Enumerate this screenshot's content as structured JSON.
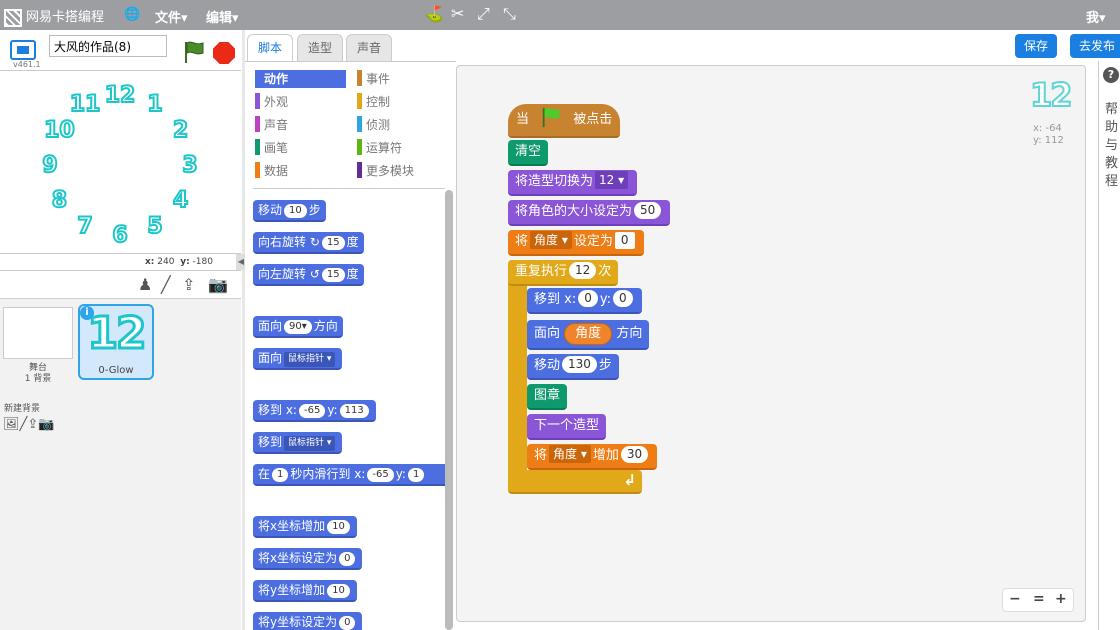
{
  "topbar": {
    "brand": "网易卡搭编程",
    "globe": "🌐",
    "file": "文件▾",
    "edit": "编辑▾",
    "user": "我▾"
  },
  "stage": {
    "version": "v461.1",
    "title_value": "大风的作品(8)",
    "coords": {
      "xl": "x:",
      "x": "240",
      "yl": "y:",
      "y": "-180"
    }
  },
  "clock": [
    "12",
    "1",
    "2",
    "3",
    "4",
    "5",
    "6",
    "7",
    "8",
    "9",
    "10",
    "11"
  ],
  "sprites": {
    "stage_label": "舞台",
    "stage_sub": "1 背景",
    "newbg": "新建背景",
    "sprite_name": "0-Glow",
    "sprite_costume": "12",
    "info": "i"
  },
  "tabs": {
    "scripts": "脚本",
    "costumes": "造型",
    "sounds": "声音"
  },
  "buttons": {
    "save": "保存",
    "publish": "去发布"
  },
  "categories": [
    {
      "label": "动作",
      "color": "#4c6ee0"
    },
    {
      "label": "事件",
      "color": "#c88330"
    },
    {
      "label": "外观",
      "color": "#8a55d7"
    },
    {
      "label": "控制",
      "color": "#e1a91a"
    },
    {
      "label": "声音",
      "color": "#bb42c3"
    },
    {
      "label": "侦测",
      "color": "#2ca5e2"
    },
    {
      "label": "画笔",
      "color": "#0e9a6c"
    },
    {
      "label": "运算符",
      "color": "#5cb712"
    },
    {
      "label": "数据",
      "color": "#ee7d16"
    },
    {
      "label": "更多模块",
      "color": "#632d99"
    }
  ],
  "palette": {
    "move": [
      "移动",
      "10",
      "步"
    ],
    "turn_right": [
      "向右旋转",
      "↻",
      "15",
      "度"
    ],
    "turn_left": [
      "向左旋转",
      "↺",
      "15",
      "度"
    ],
    "point_dir": [
      "面向",
      "90▾",
      "方向"
    ],
    "point_towards": [
      "面向",
      "鼠标指针 ▾"
    ],
    "goto_xy": [
      "移到 x:",
      "-65",
      "y:",
      "113"
    ],
    "goto": [
      "移到",
      "鼠标指针 ▾"
    ],
    "glide": [
      "在",
      "1",
      "秒内滑行到 x:",
      "-65",
      "y:",
      "1"
    ],
    "change_x": [
      "将x坐标增加",
      "10"
    ],
    "set_x": [
      "将x坐标设定为",
      "0"
    ],
    "change_y": [
      "将y坐标增加",
      "10"
    ],
    "set_y": [
      "将y坐标设定为",
      "0"
    ]
  },
  "script": {
    "hat": [
      "当",
      "被点击"
    ],
    "clear": "清空",
    "switch_costume": [
      "将造型切换为",
      "12 ▾"
    ],
    "set_size": [
      "将角色的大小设定为",
      "50"
    ],
    "set_var": [
      "将",
      "角度 ▾",
      "设定为",
      "0"
    ],
    "repeat": [
      "重复执行",
      "12",
      "次"
    ],
    "goto": [
      "移到 x:",
      "0",
      "y:",
      "0"
    ],
    "point": [
      "面向",
      "角度",
      "方向"
    ],
    "move": [
      "移动",
      "130",
      "步"
    ],
    "stamp": "图章",
    "next_costume": "下一个造型",
    "change_var": [
      "将",
      "角度 ▾",
      "增加",
      "30"
    ],
    "loop_arrow": "↲"
  },
  "workspace": {
    "costume": "12",
    "x": "x: -64",
    "y": "y: 112"
  },
  "zoom": {
    "out": "−",
    "reset": "=",
    "in": "+"
  },
  "help": {
    "q": "?",
    "text": "帮助与教程"
  }
}
